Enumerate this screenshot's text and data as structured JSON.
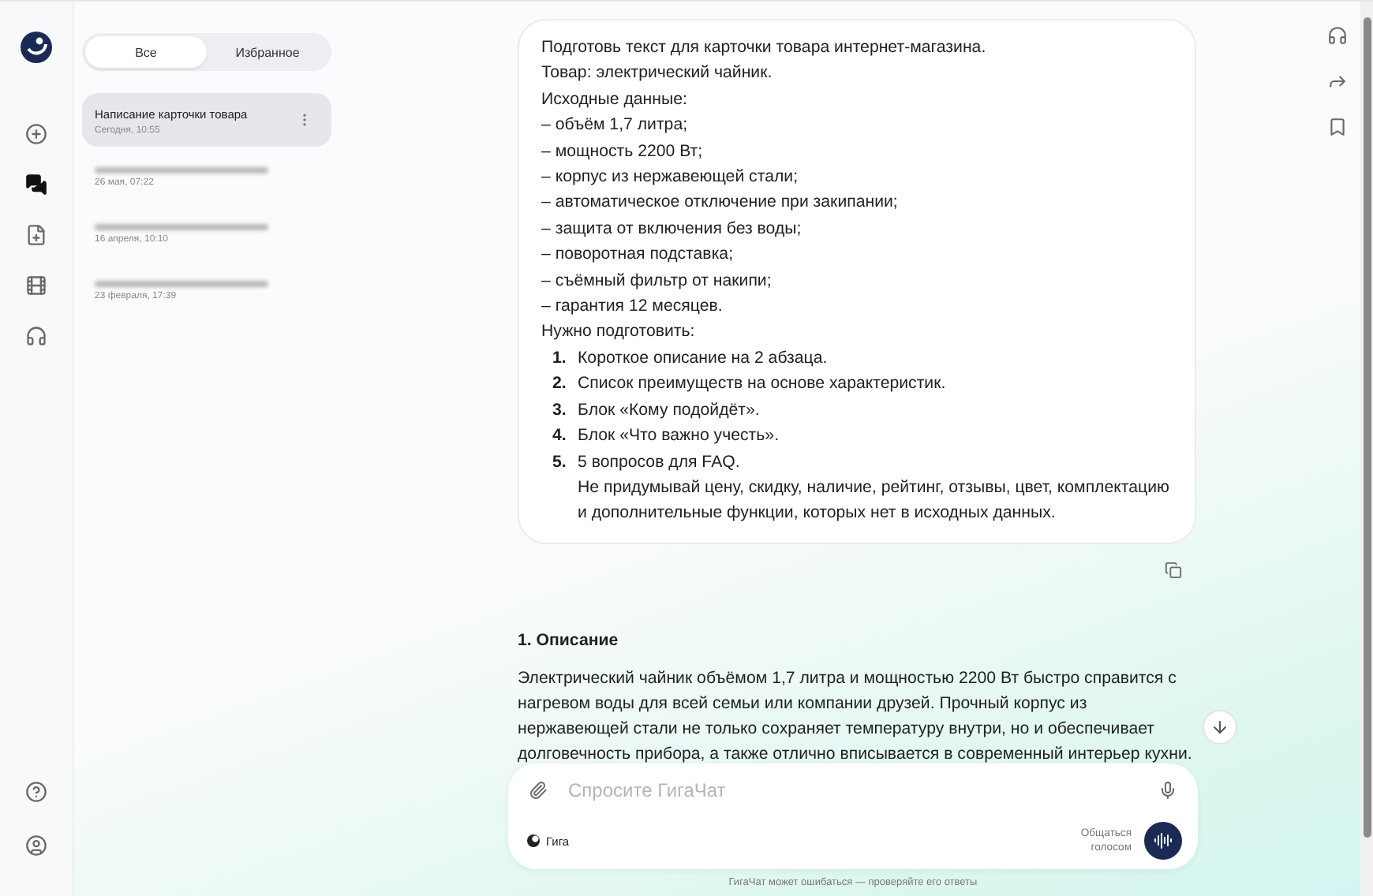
{
  "sidebar": {
    "filter_tabs": [
      {
        "label": "Все",
        "selected": true
      },
      {
        "label": "Избранное",
        "selected": false
      }
    ],
    "chats": [
      {
        "title": "Написание карточки товара",
        "time": "Сегодня, 10:55",
        "selected": true
      },
      {
        "time": "26 мая, 07:22",
        "selected": false
      },
      {
        "time": "16 апреля, 10:10",
        "selected": false
      },
      {
        "time": "23 февраля, 17:39",
        "selected": false
      }
    ]
  },
  "message": {
    "lines": [
      "Подготовь текст для карточки товара интернет-магазина.",
      "Товар: электрический чайник.",
      "Исходные данные:",
      "– объём 1,7 литра;",
      "– мощность 2200 Вт;",
      "– корпус из нержавеющей стали;",
      "– автоматическое отключение при закипании;",
      "– защита от включения без воды;",
      "– поворотная подставка;",
      "– съёмный фильтр от накипи;",
      "– гарантия 12 месяцев.",
      "Нужно подготовить:"
    ],
    "items": [
      {
        "number": "1.",
        "lines": [
          "Короткое описание на 2 абзаца."
        ]
      },
      {
        "number": "2.",
        "lines": [
          "Список преимуществ на основе характеристик."
        ]
      },
      {
        "number": "3.",
        "lines": [
          "Блок «Кому подойдёт»."
        ]
      },
      {
        "number": "4.",
        "lines": [
          "Блок «Что важно учесть»."
        ]
      },
      {
        "number": "5.",
        "lines": [
          "5 вопросов для FAQ.",
          "Не придумывай цену, скидку, наличие, рейтинг, отзывы, цвет, комплектацию и дополнительные функции, которых нет в исходных данных."
        ]
      }
    ]
  },
  "answer": {
    "heading": "1. Описание",
    "paragraph": "Электрический чайник объёмом 1,7 литра и мощностью 2200 Вт быстро справится с нагревом воды для всей семьи или компании друзей. Прочный корпус из нержавеющей стали не только сохраняет температуру внутри, но и обеспечивает долговечность прибора, а также отлично вписывается в современный интерьер кухни."
  },
  "composer": {
    "placeholder": "Спросите ГигаЧат",
    "model": "Гига",
    "voice_label": "Общаться голосом"
  },
  "disclaimer": "ГигаЧат может ошибаться — проверяйте его ответы"
}
